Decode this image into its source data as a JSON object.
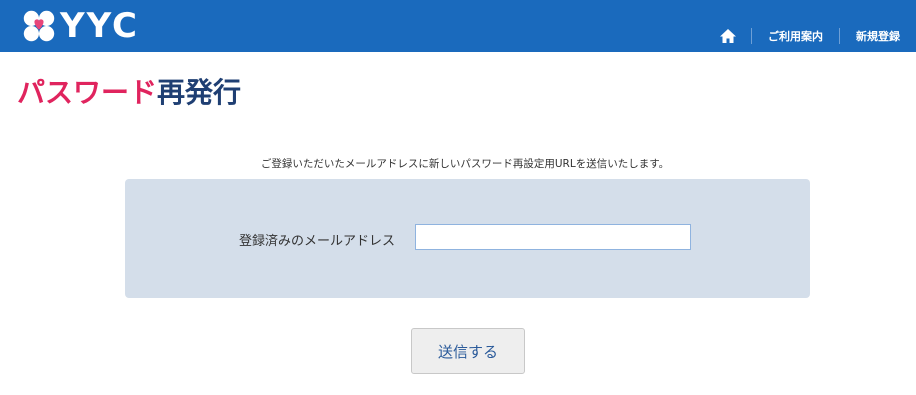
{
  "header": {
    "logo_text": "YYC",
    "nav": {
      "home_icon": "home-icon",
      "guide_label": "ご利用案内",
      "register_label": "新規登録"
    }
  },
  "page": {
    "title_highlight": "パスワード",
    "title_rest": "再発行",
    "description": "ご登録いただいたメールアドレスに新しいパスワード再設定用URLを送信いたします。"
  },
  "form": {
    "email_label": "登録済みのメールアドレス",
    "email_value": "",
    "submit_label": "送信する"
  },
  "colors": {
    "header_bg": "#1a6abd",
    "title_accent": "#e0245e",
    "title_dark": "#1f3f73",
    "panel_bg": "#d4deea"
  }
}
